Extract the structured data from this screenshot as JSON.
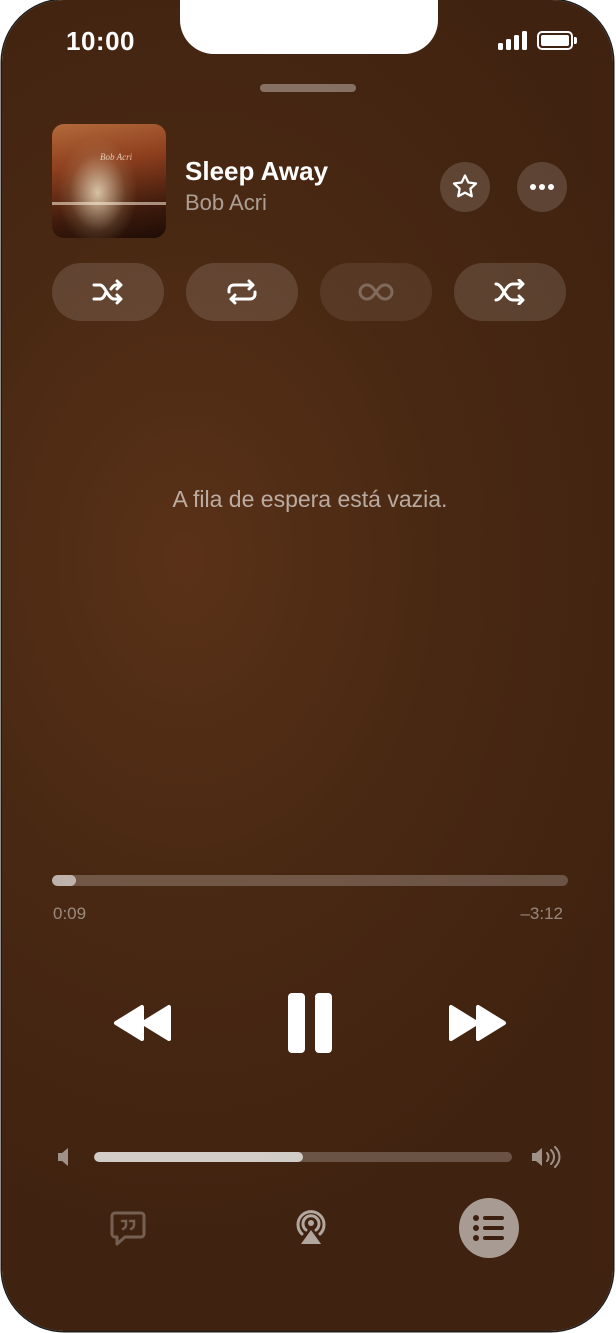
{
  "status_bar": {
    "time": "10:00"
  },
  "now_playing": {
    "title": "Sleep Away",
    "artist": "Bob Acri",
    "artwork_caption": "Bob Acri"
  },
  "actions": {
    "favorite_icon": "star-icon",
    "more_icon": "ellipsis-icon"
  },
  "modes": [
    {
      "name": "shuffle",
      "icon": "shuffle-icon",
      "enabled": true
    },
    {
      "name": "repeat",
      "icon": "repeat-icon",
      "enabled": true
    },
    {
      "name": "autoplay",
      "icon": "infinity-icon",
      "enabled": false
    },
    {
      "name": "crossfade",
      "icon": "crossfade-icon",
      "enabled": true
    }
  ],
  "queue": {
    "empty_message": "A fila de espera está vazia."
  },
  "playback": {
    "elapsed": "0:09",
    "remaining": "–3:12",
    "progress_fraction": 0.047,
    "state": "playing"
  },
  "volume": {
    "level_fraction": 0.5
  },
  "bottom_bar": {
    "lyrics_icon": "lyrics-icon",
    "airplay_icon": "airplay-icon",
    "queue_icon": "queue-list-icon",
    "active": "queue"
  },
  "colors": {
    "background": "#4a2913",
    "accent_text": "#ffffff"
  }
}
